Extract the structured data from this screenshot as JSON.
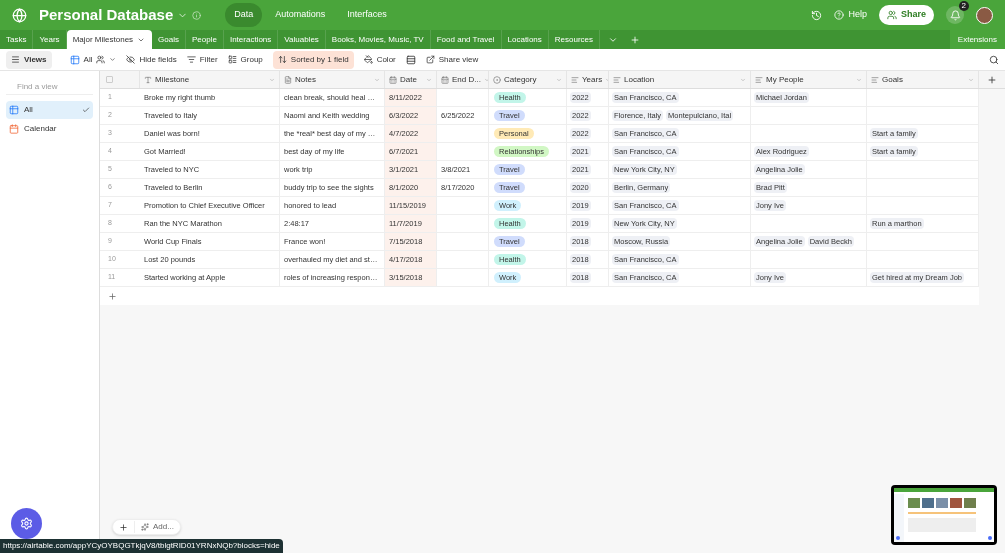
{
  "base": {
    "title": "Personal Database"
  },
  "header_nav": [
    {
      "label": "Data",
      "selected": true
    },
    {
      "label": "Automations",
      "selected": false
    },
    {
      "label": "Interfaces",
      "selected": false
    }
  ],
  "header_actions": {
    "help": "Help",
    "share": "Share",
    "notifications": "2"
  },
  "tables": [
    {
      "label": "Tasks",
      "selected": false
    },
    {
      "label": "Years",
      "selected": false
    },
    {
      "label": "Major Milestones",
      "selected": true
    },
    {
      "label": "Goals",
      "selected": false
    },
    {
      "label": "People",
      "selected": false
    },
    {
      "label": "Interactions",
      "selected": false
    },
    {
      "label": "Valuables",
      "selected": false
    },
    {
      "label": "Books, Movies, Music, TV",
      "selected": false
    },
    {
      "label": "Food and Travel",
      "selected": false
    },
    {
      "label": "Locations",
      "selected": false
    },
    {
      "label": "Resources",
      "selected": false
    }
  ],
  "extensions": "Extensions",
  "toolbar": {
    "views": "Views",
    "view_name": "All",
    "hide_fields": "Hide fields",
    "filter": "Filter",
    "group": "Group",
    "sort": "Sorted by 1 field",
    "color_label": "Color",
    "share_view": "Share view"
  },
  "sidebar": {
    "search_placeholder": "Find a view",
    "views": [
      {
        "label": "All",
        "kind": "grid",
        "selected": true
      },
      {
        "label": "Calendar",
        "kind": "calendar",
        "selected": false
      }
    ]
  },
  "table": {
    "select_all": {
      "checked": false
    },
    "columns": [
      "Milestone",
      "Notes",
      "Date",
      "End D...",
      "Category",
      "Years",
      "Location",
      "My People",
      "Goals"
    ],
    "rows": [
      {
        "n": "1",
        "milestone": "Broke my right thumb",
        "notes": "clean break, should heal …",
        "date": "8/11/2022",
        "end": "",
        "category": {
          "label": "Health",
          "color": "#c2f5e9"
        },
        "year": "2022",
        "locations": [
          "San Francisco, CA"
        ],
        "people": [
          "Michael Jordan"
        ],
        "goals": []
      },
      {
        "n": "2",
        "milestone": "Traveled to Italy",
        "notes": "Naomi and Keith wedding",
        "date": "6/3/2022",
        "end": "6/25/2022",
        "category": {
          "label": "Travel",
          "color": "#d0dcfc"
        },
        "year": "2022",
        "locations": [
          "Florence, Italy",
          "Montepulciano, Ital"
        ],
        "people": [],
        "goals": []
      },
      {
        "n": "3",
        "milestone": "Daniel was born!",
        "notes": "the *real* best day of my …",
        "date": "4/7/2022",
        "end": "",
        "category": {
          "label": "Personal",
          "color": "#ffeab6"
        },
        "year": "2022",
        "locations": [
          "San Francisco, CA"
        ],
        "people": [],
        "goals": [
          "Start a family"
        ]
      },
      {
        "n": "4",
        "milestone": "Got Married!",
        "notes": "best day of my life",
        "date": "6/7/2021",
        "end": "",
        "category": {
          "label": "Relationships",
          "color": "#d1f7c4"
        },
        "year": "2021",
        "locations": [
          "San Francisco, CA"
        ],
        "people": [
          "Alex Rodriguez"
        ],
        "goals": [
          "Start a family"
        ]
      },
      {
        "n": "5",
        "milestone": "Traveled to NYC",
        "notes": "work trip",
        "date": "3/1/2021",
        "end": "3/8/2021",
        "category": {
          "label": "Travel",
          "color": "#d0dcfc"
        },
        "year": "2021",
        "locations": [
          "New York City, NY"
        ],
        "people": [
          "Angelina Jolie"
        ],
        "goals": []
      },
      {
        "n": "6",
        "milestone": "Traveled to Berlin",
        "notes": "buddy trip to see the sights",
        "date": "8/1/2020",
        "end": "8/17/2020",
        "category": {
          "label": "Travel",
          "color": "#d0dcfc"
        },
        "year": "2020",
        "locations": [
          "Berlin, Germany"
        ],
        "people": [
          "Brad Pitt"
        ],
        "goals": []
      },
      {
        "n": "7",
        "milestone": "Promotion to Chief Executive Officer",
        "notes": "honored to lead",
        "date": "11/15/2019",
        "end": "",
        "category": {
          "label": "Work",
          "color": "#d0f0fd"
        },
        "year": "2019",
        "locations": [
          "San Francisco, CA"
        ],
        "people": [
          "Jony Ive"
        ],
        "goals": []
      },
      {
        "n": "8",
        "milestone": "Ran the NYC Marathon",
        "notes": "2:48:17",
        "date": "11/7/2019",
        "end": "",
        "category": {
          "label": "Health",
          "color": "#c2f5e9"
        },
        "year": "2019",
        "locations": [
          "New York City, NY"
        ],
        "people": [],
        "goals": [
          "Run a marthon"
        ]
      },
      {
        "n": "9",
        "milestone": "World Cup Finals",
        "notes": "France won!",
        "date": "7/15/2018",
        "end": "",
        "category": {
          "label": "Travel",
          "color": "#d0dcfc"
        },
        "year": "2018",
        "locations": [
          "Moscow, Russia"
        ],
        "people": [
          "Angelina Jolie",
          "David Beckh"
        ],
        "goals": []
      },
      {
        "n": "10",
        "milestone": "Lost 20 pounds",
        "notes": "overhauled my diet and st…",
        "date": "4/17/2018",
        "end": "",
        "category": {
          "label": "Health",
          "color": "#c2f5e9"
        },
        "year": "2018",
        "locations": [
          "San Francisco, CA"
        ],
        "people": [],
        "goals": []
      },
      {
        "n": "11",
        "milestone": "Started working at Apple",
        "notes": "roles of increasing respon…",
        "date": "3/15/2018",
        "end": "",
        "category": {
          "label": "Work",
          "color": "#d0f0fd"
        },
        "year": "2018",
        "locations": [
          "San Francisco, CA"
        ],
        "people": [
          "Jony Ive"
        ],
        "goals": [
          "Get hired at my Dream Job"
        ]
      }
    ]
  },
  "footer": {
    "add_label": "Add..."
  },
  "status_url": "https://airtable.com/appYCyOYBQGTkjqV8/tblgtRID01YRNxNQb?blocks=hide"
}
